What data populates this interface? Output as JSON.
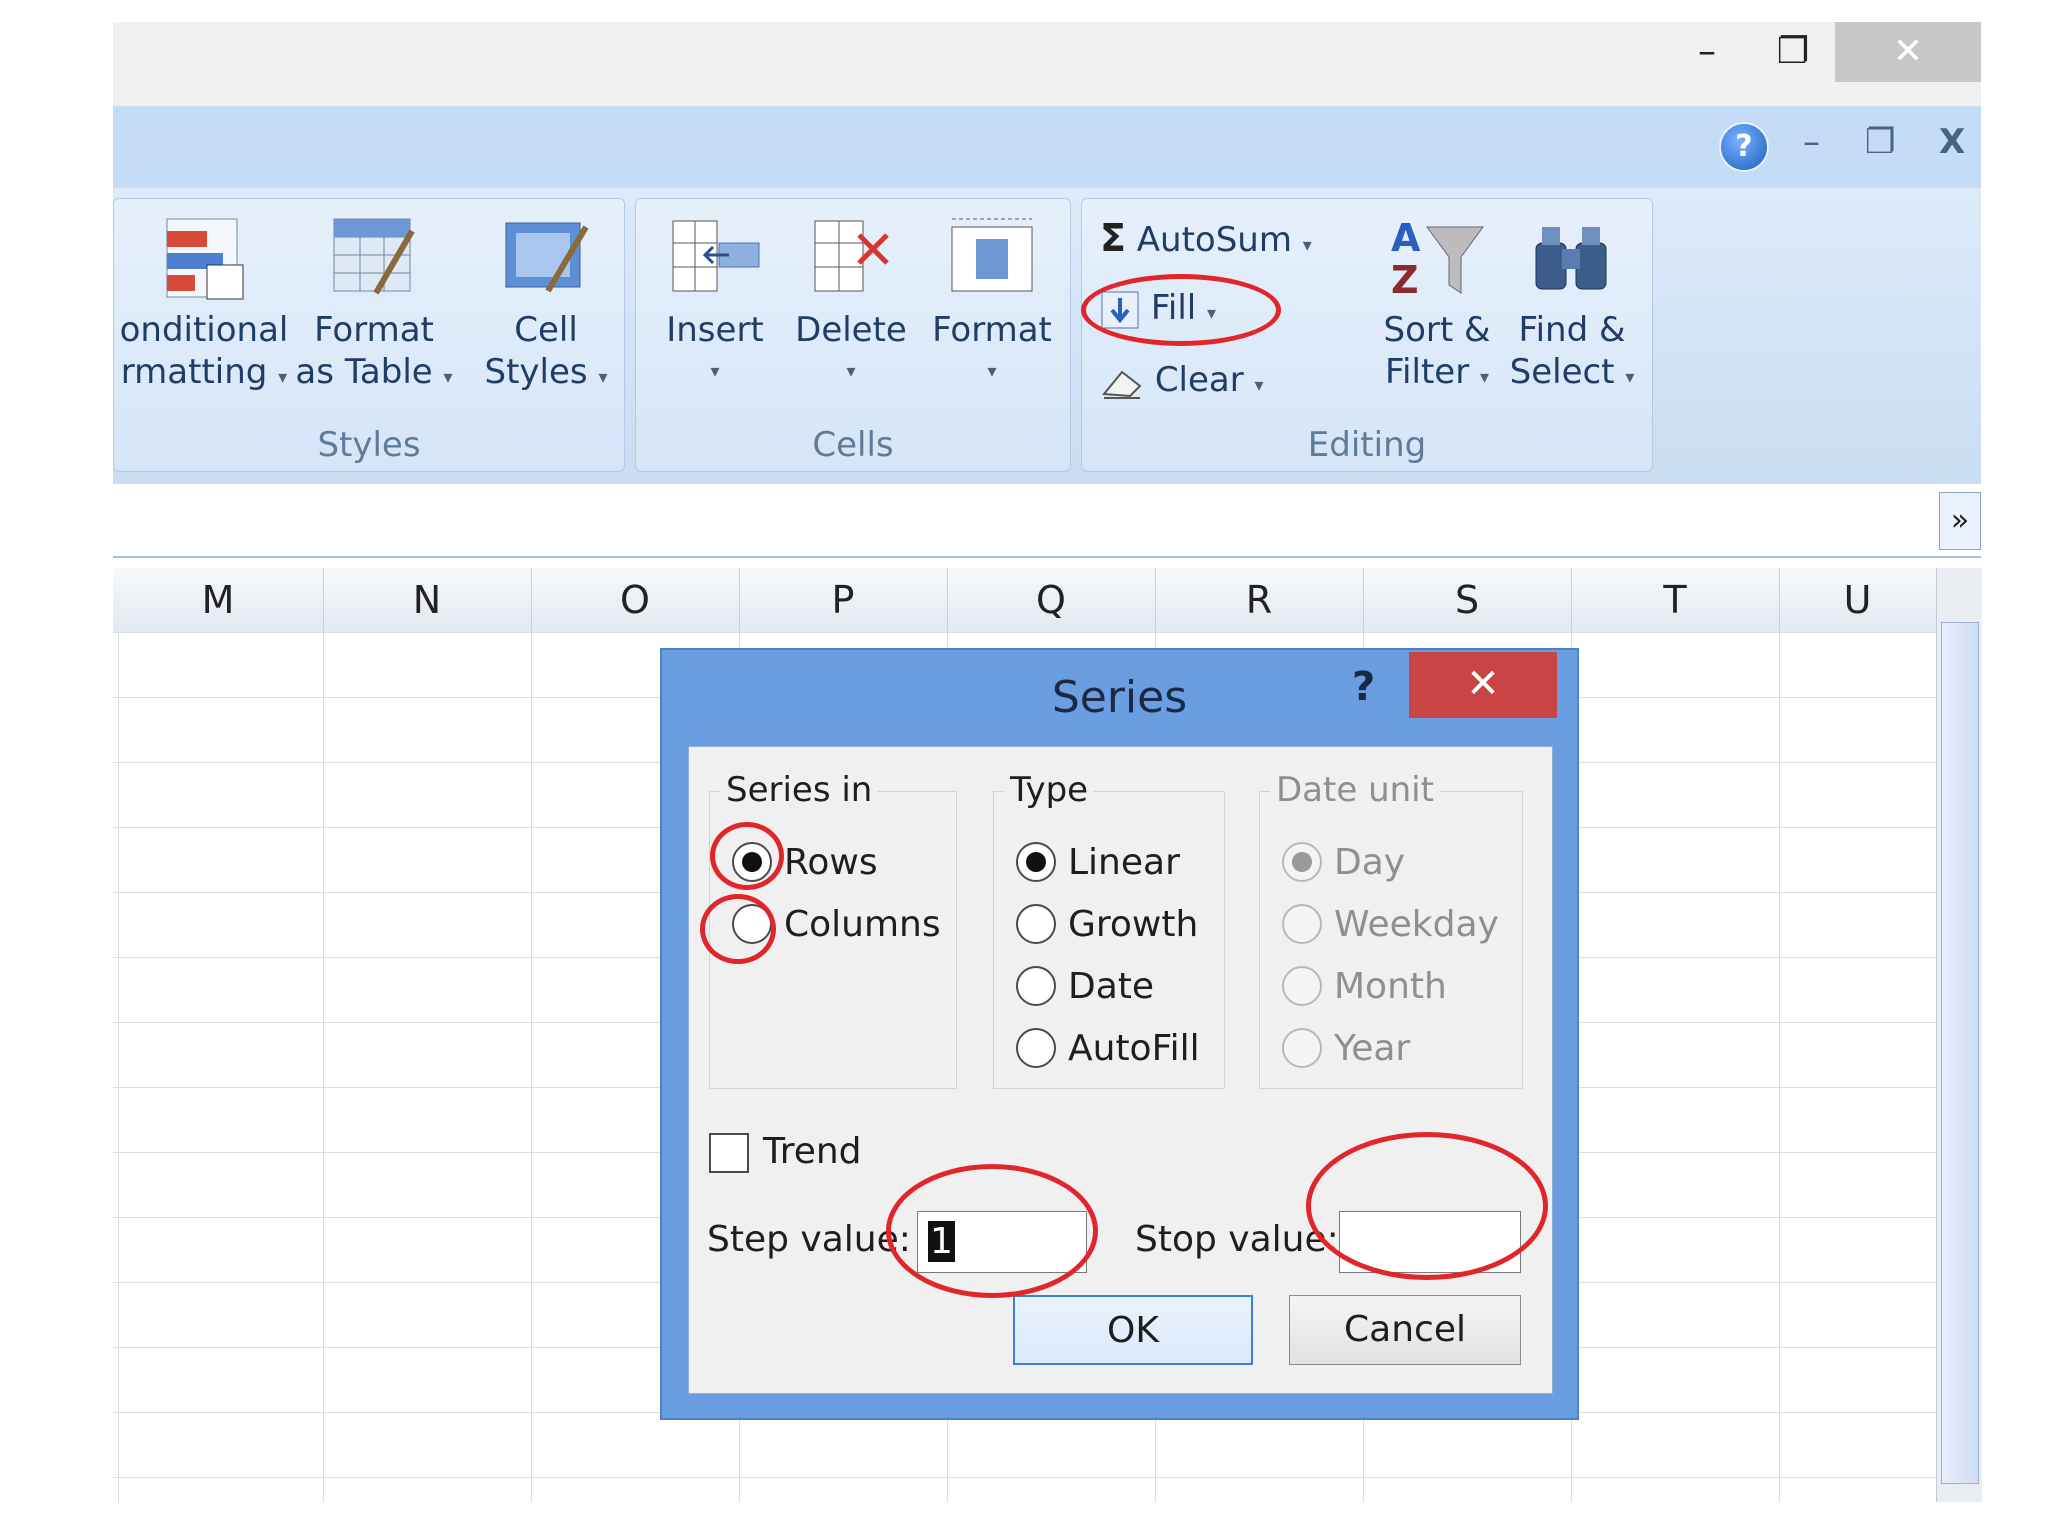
{
  "window": {
    "minimize_glyph": "–",
    "restore_glyph": "❐",
    "close_glyph": "✕",
    "inner_minimize_glyph": "–",
    "inner_restore_glyph": "❐",
    "inner_close_glyph": "X",
    "help_glyph": "?"
  },
  "ribbon": {
    "groups": [
      {
        "label": "Styles",
        "buttons": [
          {
            "line1": "onditional",
            "line2": "rmatting"
          },
          {
            "line1": "Format",
            "line2": "as Table"
          },
          {
            "line1": "Cell",
            "line2": "Styles"
          }
        ]
      },
      {
        "label": "Cells",
        "buttons": [
          {
            "line1": "Insert"
          },
          {
            "line1": "Delete"
          },
          {
            "line1": "Format"
          }
        ]
      },
      {
        "label": "Editing",
        "autosum": "AutoSum",
        "fill": "Fill",
        "clear": "Clear",
        "sort_line1": "Sort &",
        "sort_line2": "Filter",
        "find_line1": "Find &",
        "find_line2": "Select"
      }
    ],
    "dropdown_glyph": "▾",
    "sigma_glyph": "Σ",
    "expand_glyph": "»"
  },
  "columns": [
    "M",
    "N",
    "O",
    "P",
    "Q",
    "R",
    "S",
    "T",
    "U"
  ],
  "dialog": {
    "title": "Series",
    "help": "?",
    "close": "✕",
    "series_in": {
      "legend": "Series in",
      "options": [
        "Rows",
        "Columns"
      ],
      "selected": "Rows"
    },
    "type": {
      "legend": "Type",
      "options": [
        "Linear",
        "Growth",
        "Date",
        "AutoFill"
      ],
      "selected": "Linear"
    },
    "date_unit": {
      "legend": "Date unit",
      "options": [
        "Day",
        "Weekday",
        "Month",
        "Year"
      ],
      "selected": "Day",
      "disabled": true
    },
    "trend_label": "Trend",
    "step_label": "Step value:",
    "step_value": "1",
    "stop_label": "Stop value:",
    "stop_value": "",
    "ok": "OK",
    "cancel": "Cancel"
  },
  "annotation_color": "#e0262a"
}
